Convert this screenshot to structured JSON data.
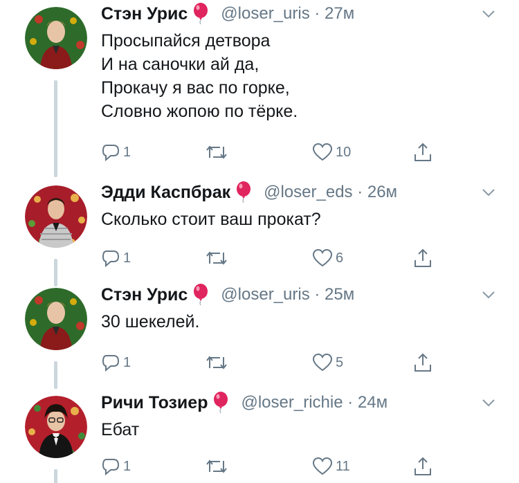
{
  "tweets": [
    {
      "name": "Стэн Урис",
      "handle": "@loser_uris · 27м",
      "lines": [
        "Просыпайся детвора",
        "И на саночки ай да,",
        "Прокачу я вас по горке,",
        "Словно жопою по тёрке."
      ],
      "replies": "1",
      "retweets": "",
      "likes": "10",
      "avatar": "stan"
    },
    {
      "name": "Эдди Каспбрак",
      "handle": "@loser_eds · 26м",
      "lines": [
        "Сколько стоит ваш прокат?"
      ],
      "replies": "1",
      "retweets": "",
      "likes": "6",
      "avatar": "eddie"
    },
    {
      "name": "Стэн Урис",
      "handle": "@loser_uris · 25м",
      "lines": [
        "30 шекелей."
      ],
      "replies": "1",
      "retweets": "",
      "likes": "5",
      "avatar": "stan"
    },
    {
      "name": "Ричи Тозиер",
      "handle": "@loser_richie · 24м",
      "lines": [
        "Ебат"
      ],
      "replies": "1",
      "retweets": "",
      "likes": "11",
      "avatar": "richie"
    }
  ],
  "icons": {
    "balloon": "red-balloon-icon",
    "reply": "reply-icon",
    "retweet": "retweet-icon",
    "like": "heart-icon",
    "share": "share-icon",
    "caret": "chevron-down-icon"
  },
  "colors": {
    "text": "#14171a",
    "muted": "#657786",
    "thread_line": "#ccd6dd",
    "balloon": "#e0245e"
  }
}
